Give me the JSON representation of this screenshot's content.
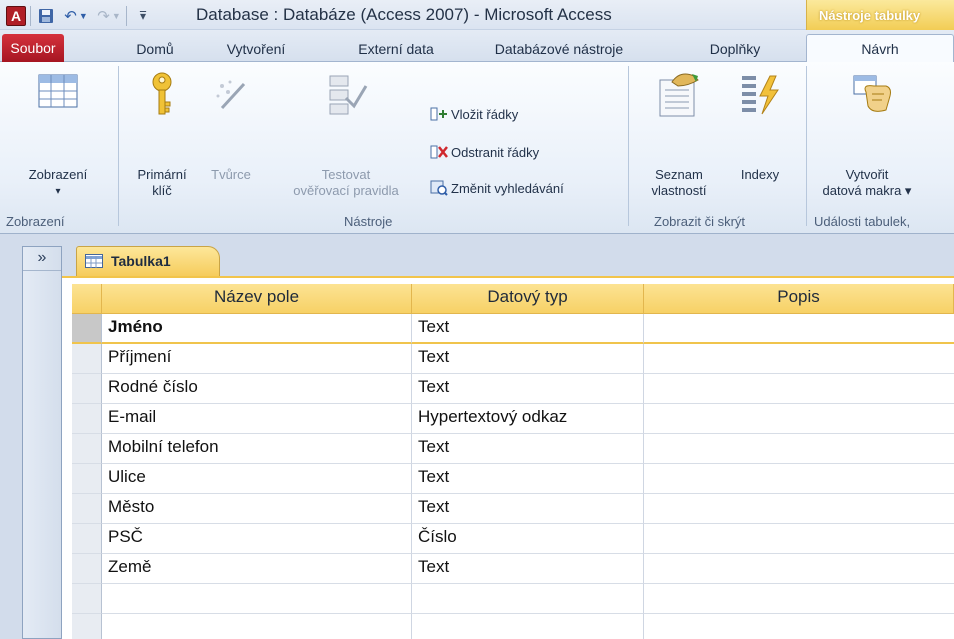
{
  "window": {
    "title": "Database  : Databáze (Access 2007)  -  Microsoft Access",
    "context_tab_group": "Nástroje tabulky",
    "app_logo_letter": "A"
  },
  "ribbon_tabs": [
    "Soubor",
    "Domů",
    "Vytvoření",
    "Externí data",
    "Databázové nástroje",
    "Doplňky",
    "Návrh"
  ],
  "ribbon": {
    "zobrazeni": {
      "view_button": "Zobrazení",
      "view_arrow": "▾",
      "group_label": "Zobrazení"
    },
    "nastroje": {
      "primary_key_line1": "Primární",
      "primary_key_line2": "klíč",
      "builder": "Tvůrce",
      "test_rules_line1": "Testovat",
      "test_rules_line2": "ověřovací pravidla",
      "insert_rows": "Vložit řádky",
      "delete_rows": "Odstranit řádky",
      "modify_lookups": "Změnit vyhledávání",
      "group_label": "Nástroje"
    },
    "zobrazit_skryt": {
      "property_sheet_line1": "Seznam",
      "property_sheet_line2": "vlastností",
      "indexes": "Indexy",
      "group_label": "Zobrazit či skrýt"
    },
    "udalosti": {
      "create_macros_line1": "Vytvořit",
      "create_macros_line2": "datová makra ▾",
      "group_label": "Události tabulek,"
    }
  },
  "nav_pane": {
    "toggle": "»"
  },
  "document": {
    "tab_label": "Tabulka1",
    "columns": [
      "Název pole",
      "Datový typ",
      "Popis"
    ],
    "rows": [
      {
        "name": "Jméno",
        "type": "Text",
        "desc": ""
      },
      {
        "name": "Příjmení",
        "type": "Text",
        "desc": ""
      },
      {
        "name": "Rodné číslo",
        "type": "Text",
        "desc": ""
      },
      {
        "name": "E-mail",
        "type": "Hypertextový odkaz",
        "desc": ""
      },
      {
        "name": "Mobilní telefon",
        "type": "Text",
        "desc": ""
      },
      {
        "name": "Ulice",
        "type": "Text",
        "desc": ""
      },
      {
        "name": "Město",
        "type": "Text",
        "desc": ""
      },
      {
        "name": "PSČ",
        "type": "Číslo",
        "desc": ""
      },
      {
        "name": "Země",
        "type": "Text",
        "desc": ""
      },
      {
        "name": "",
        "type": "",
        "desc": ""
      },
      {
        "name": "",
        "type": "",
        "desc": ""
      }
    ],
    "current_row_index": 0
  },
  "colors": {
    "file_tab": "#c4202b",
    "context_accent": "#f2c44a",
    "ribbon_bg": "#e9f0f9"
  }
}
